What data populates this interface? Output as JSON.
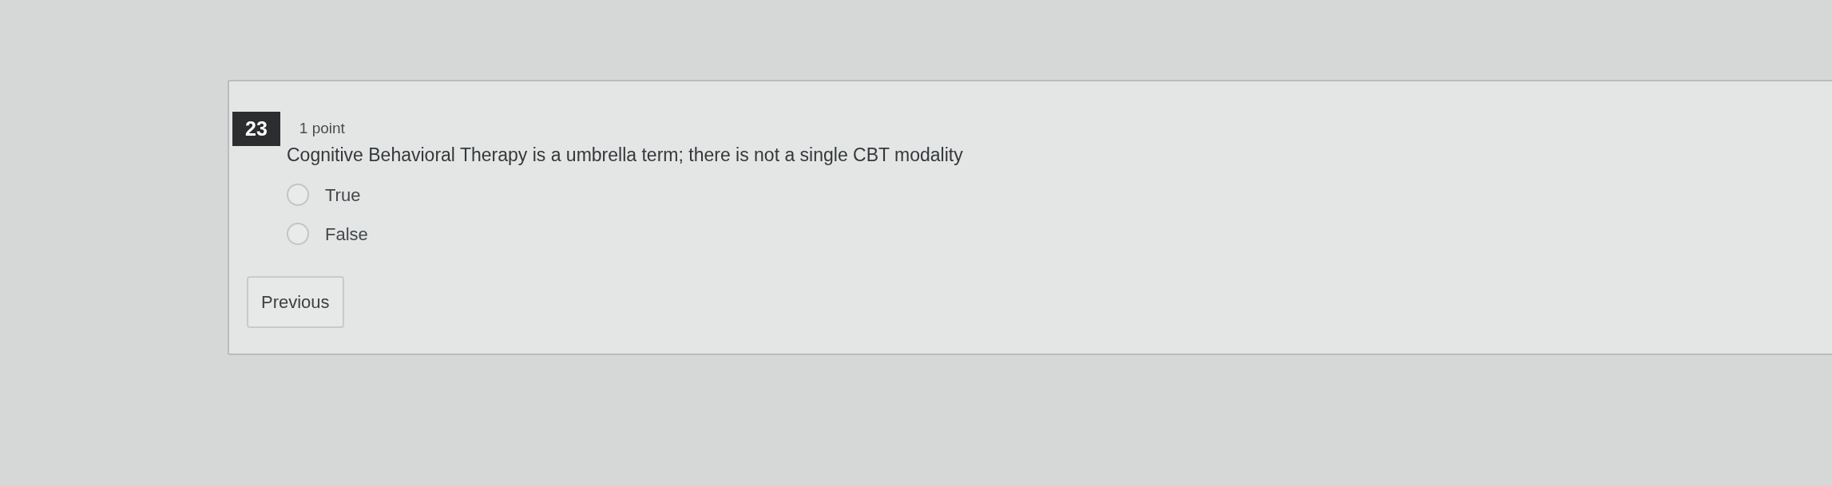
{
  "question": {
    "number": "23",
    "points": "1 point",
    "text": "Cognitive Behavioral Therapy is a umbrella term; there is not a single CBT modality",
    "options": [
      {
        "label": "True",
        "selected": false
      },
      {
        "label": "False",
        "selected": false
      }
    ]
  },
  "navigation": {
    "previous_button": "Previous"
  }
}
